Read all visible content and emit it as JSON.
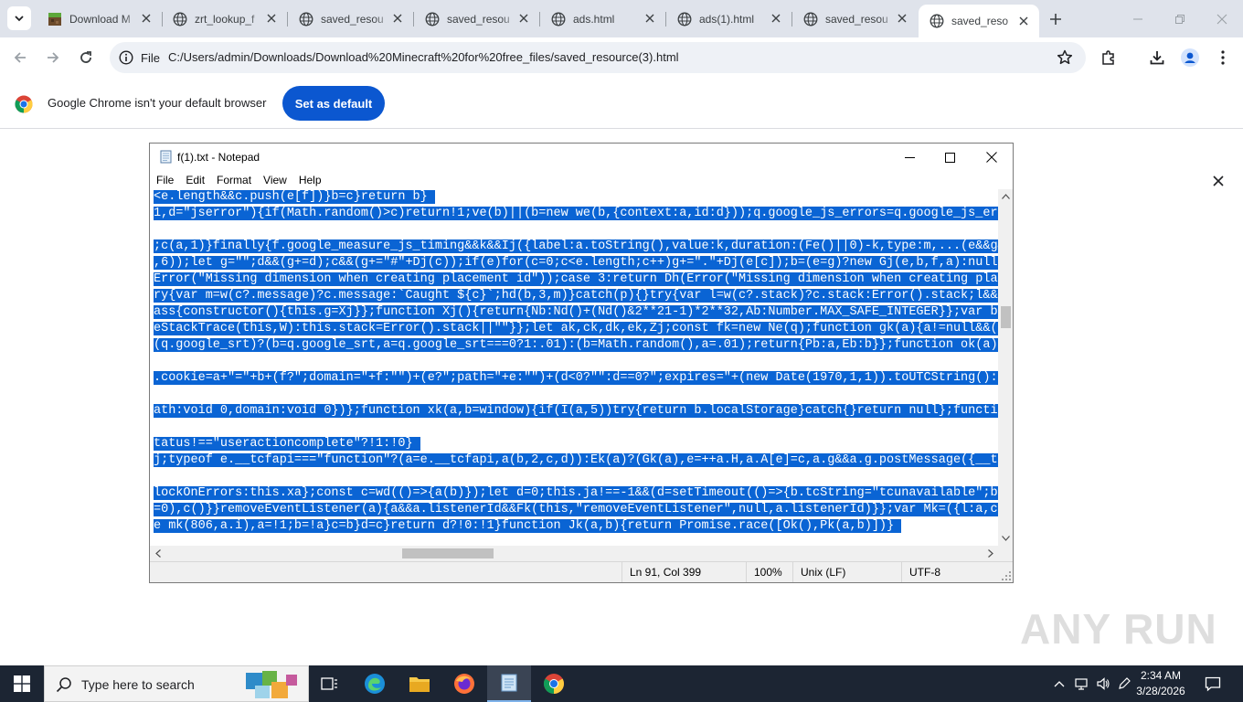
{
  "browser": {
    "tabs": [
      {
        "title": "Download M",
        "icon": "minecraft-icon"
      },
      {
        "title": "zrt_lookup_f",
        "icon": "globe-icon"
      },
      {
        "title": "saved_resou",
        "icon": "globe-icon"
      },
      {
        "title": "saved_resou",
        "icon": "globe-icon"
      },
      {
        "title": "ads.html",
        "icon": "globe-icon"
      },
      {
        "title": "ads(1).html",
        "icon": "globe-icon"
      },
      {
        "title": "saved_resou",
        "icon": "globe-icon"
      },
      {
        "title": "saved_reso",
        "icon": "globe-icon",
        "active": true
      }
    ],
    "address": {
      "chip_label": "File",
      "url": "C:/Users/admin/Downloads/Download%20Minecraft%20for%20free_files/saved_resource(3).html"
    },
    "infobar": {
      "message": "Google Chrome isn't your default browser",
      "button_label": "Set as default"
    },
    "accent_color": "#0b57d0"
  },
  "notepad": {
    "title": "f(1).txt - Notepad",
    "menu": [
      "File",
      "Edit",
      "Format",
      "View",
      "Help"
    ],
    "lines": [
      "<e.length&&c.push(e[f])}b=c}return b} ",
      "1,d=\"jserror\"){if(Math.random()>c)return!1;ve(b)||(b=new we(b,{context:a,id:d}));q.google_js_errors=q.google_js_err",
      "",
      ";c(a,1)}finally{f.google_measure_js_timing&&k&&Ij({label:a.toString(),value:k,duration:(Fe()||0)-k,type:m,...(e&&g&",
      ",6));let g=\"\";d&&(g+=d);c&&(g+=\"#\"+Dj(c));if(e)for(c=0;c<e.length;c++)g+=\".\"+Dj(e[c]);b=(e=g)?new Gj(e,b,f,a):null}",
      "Error(\"Missing dimension when creating placement id\"));case 3:return Dh(Error(\"Missing dimension when creating plac",
      "ry{var m=w(c?.message)?c.message:`Caught ${c}`;hd(b,3,m)}catch(p){}try{var l=w(c?.stack)?c.stack:Error().stack;l&&I",
      "ass{constructor(){this.g=Xj}};function Xj(){return{Nb:Nd()+(Nd()&2**21-1)*2**32,Ab:Number.MAX_SAFE_INTEGER}};var bk",
      "eStackTrace(this,W):this.stack=Error().stack||\"\"}};let ak,ck,dk,ek,Zj;const fk=new Ne(q);function gk(a){a!=null&&(q",
      "(q.google_srt)?(b=q.google_srt,a=q.google_srt===0?1:.01):(b=Math.random(),a=.01);return{Pb:a,Eb:b}};function ok(a){",
      "",
      ".cookie=a+\"=\"+b+(f?\";domain=\"+f:\"\")+(e?\";path=\"+e:\"\")+(d<0?\"\":d==0?\";expires=\"+(new Date(1970,1,1)).toUTCString():\"",
      "",
      "ath:void 0,domain:void 0})};function xk(a,b=window){if(I(a,5))try{return b.localStorage}catch{}return null};functio",
      "",
      "tatus!==\"useractioncomplete\"?!1:!0} ",
      "j;typeof e.__tcfapi===\"function\"?(a=e.__tcfapi,a(b,2,c,d)):Ek(a)?(Gk(a),e=++a.H,a.A[e]=c,a.g&&a.g.postMessage({__tc",
      "",
      "lockOnErrors:this.xa};const c=wd(()=>{a(b)});let d=0;this.ja!==-1&&(d=setTimeout(()=>{b.tcString=\"tcunavailable\";b.",
      "=0),c()}}removeEventListener(a){a&&a.listenerId&&Fk(this,\"removeEventListener\",null,a.listenerId)}};var Mk=({l:a,ca",
      "e mk(806,a.i),a=!1;b=!a}c=b}d=c}return d?!0:!1}function Jk(a,b){return Promise.race([Ok(),Pk(a,b)])} "
    ],
    "status": {
      "position": "Ln 91, Col 399",
      "zoom": "100%",
      "line_ending": "Unix (LF)",
      "encoding": "UTF-8"
    },
    "selection_color": "#0a64d4"
  },
  "watermark": "ANY RUN",
  "taskbar": {
    "search_placeholder": "Type here to search",
    "apps": [
      "task-view-icon",
      "edge-icon",
      "file-explorer-icon",
      "firefox-icon",
      "notepad-icon",
      "chrome-icon"
    ],
    "clock_time": "2:34 AM",
    "clock_date": "3/28/2026"
  }
}
